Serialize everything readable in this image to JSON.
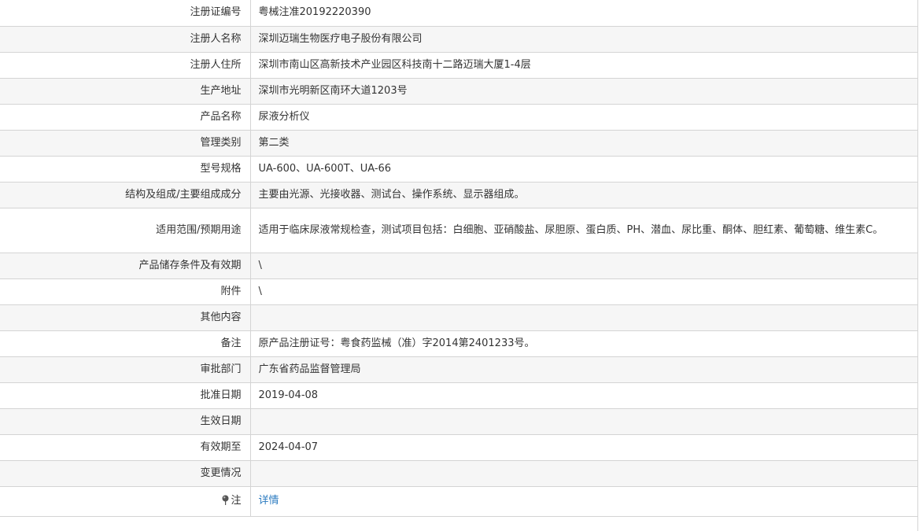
{
  "rows": [
    {
      "label": "注册证编号",
      "value": "粤械注准20192220390"
    },
    {
      "label": "注册人名称",
      "value": "深圳迈瑞生物医疗电子股份有限公司"
    },
    {
      "label": "注册人住所",
      "value": "深圳市南山区高新技术产业园区科技南十二路迈瑞大厦1-4层"
    },
    {
      "label": "生产地址",
      "value": "深圳市光明新区南环大道1203号"
    },
    {
      "label": "产品名称",
      "value": "尿液分析仪"
    },
    {
      "label": "管理类别",
      "value": "第二类"
    },
    {
      "label": "型号规格",
      "value": "UA-600、UA-600T、UA-66"
    },
    {
      "label": "结构及组成/主要组成成分",
      "value": "主要由光源、光接收器、测试台、操作系统、显示器组成。"
    },
    {
      "label": "适用范围/预期用途",
      "value": "适用于临床尿液常规检查，测试项目包括：白细胞、亚硝酸盐、尿胆原、蛋白质、PH、潜血、尿比重、酮体、胆红素、葡萄糖、维生素C。"
    },
    {
      "label": "产品储存条件及有效期",
      "value": "\\"
    },
    {
      "label": "附件",
      "value": "\\"
    },
    {
      "label": "其他内容",
      "value": ""
    },
    {
      "label": "备注",
      "value": "原产品注册证号：粤食药监械（准）字2014第2401233号。"
    },
    {
      "label": "审批部门",
      "value": "广东省药品监督管理局"
    },
    {
      "label": "批准日期",
      "value": "2019-04-08"
    },
    {
      "label": "生效日期",
      "value": ""
    },
    {
      "label": "有效期至",
      "value": "2024-04-07"
    },
    {
      "label": "变更情况",
      "value": ""
    }
  ],
  "footer": {
    "label": "注",
    "icon": "pin-icon",
    "link_text": "详情",
    "link_color": "#2b7bc0"
  }
}
